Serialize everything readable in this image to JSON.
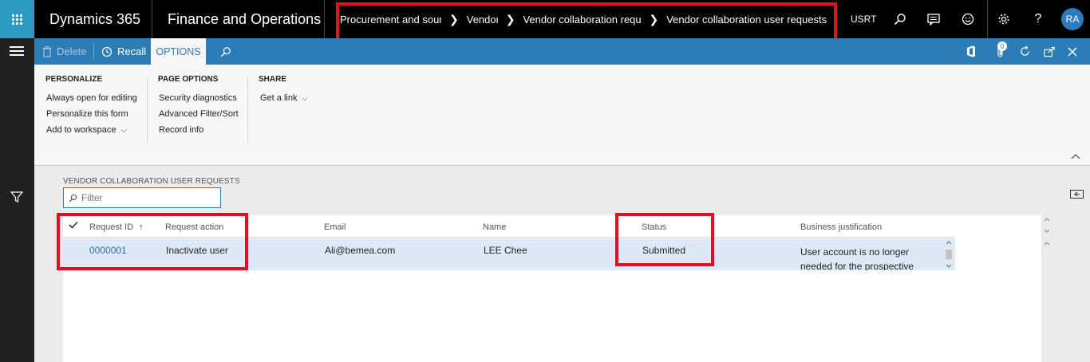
{
  "topbar": {
    "brand": "Dynamics 365",
    "app": "Finance and Operations",
    "breadcrumb": [
      "Procurement and sourcing",
      "Vendors",
      "Vendor collaboration requests",
      "Vendor collaboration user requests"
    ],
    "company": "USRT",
    "avatar": "RA",
    "icons": [
      "waffle-icon",
      "search-icon",
      "feedback-icon",
      "smiley-icon",
      "gear-icon",
      "help-icon"
    ]
  },
  "actionpane": {
    "delete_label": "Delete",
    "recall_label": "Recall",
    "options_tab": "OPTIONS",
    "attachments_count": "0",
    "icons": [
      "office-icon",
      "attachment-icon",
      "refresh-icon",
      "open-new-window-icon",
      "close-icon"
    ]
  },
  "ribbon": {
    "personalize": {
      "title": "PERSONALIZE",
      "items": [
        "Always open for editing",
        "Personalize this form",
        "Add to workspace"
      ]
    },
    "page_options": {
      "title": "PAGE OPTIONS",
      "items": [
        "Security diagnostics",
        "Advanced Filter/Sort",
        "Record info"
      ]
    },
    "share": {
      "title": "SHARE",
      "items": [
        "Get a link"
      ]
    }
  },
  "content": {
    "section_title": "VENDOR COLLABORATION USER REQUESTS",
    "filter_placeholder": "Filter"
  },
  "grid": {
    "columns": [
      "Request ID",
      "Request action",
      "Email",
      "Name",
      "Status",
      "Business justification"
    ],
    "sort_indicator": "↑",
    "rows": [
      {
        "request_id": "0000001",
        "request_action": "Inactivate user",
        "email": "Ali@bemea.com",
        "name": "LEE Chee",
        "status": "Submitted",
        "business_justification": "User account is no longer needed for the prospective vendor"
      }
    ]
  },
  "colors": {
    "topbar": "#000000",
    "accent": "#2e7cb6",
    "waffle": "#2d9bc1",
    "highlight": "#e0121d",
    "selected_row": "#dde9f6"
  }
}
